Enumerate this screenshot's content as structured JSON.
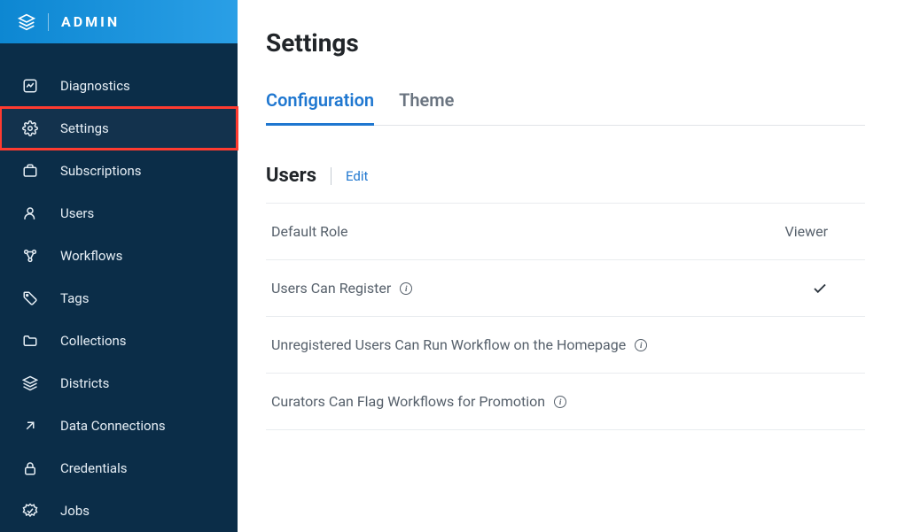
{
  "header": {
    "brand": "ADMIN"
  },
  "sidebar": {
    "items": [
      {
        "label": "Diagnostics"
      },
      {
        "label": "Settings"
      },
      {
        "label": "Subscriptions"
      },
      {
        "label": "Users"
      },
      {
        "label": "Workflows"
      },
      {
        "label": "Tags"
      },
      {
        "label": "Collections"
      },
      {
        "label": "Districts"
      },
      {
        "label": "Data Connections"
      },
      {
        "label": "Credentials"
      },
      {
        "label": "Jobs"
      }
    ]
  },
  "page": {
    "title": "Settings"
  },
  "tabs": {
    "configuration": "Configuration",
    "theme": "Theme"
  },
  "section": {
    "title": "Users",
    "edit": "Edit"
  },
  "settings": {
    "default_role": {
      "label": "Default Role",
      "value": "Viewer"
    },
    "users_can_register": {
      "label": "Users Can Register"
    },
    "unregistered_run": {
      "label": "Unregistered Users Can Run Workflow on the Homepage"
    },
    "curators_flag": {
      "label": "Curators Can Flag Workflows for Promotion"
    }
  }
}
